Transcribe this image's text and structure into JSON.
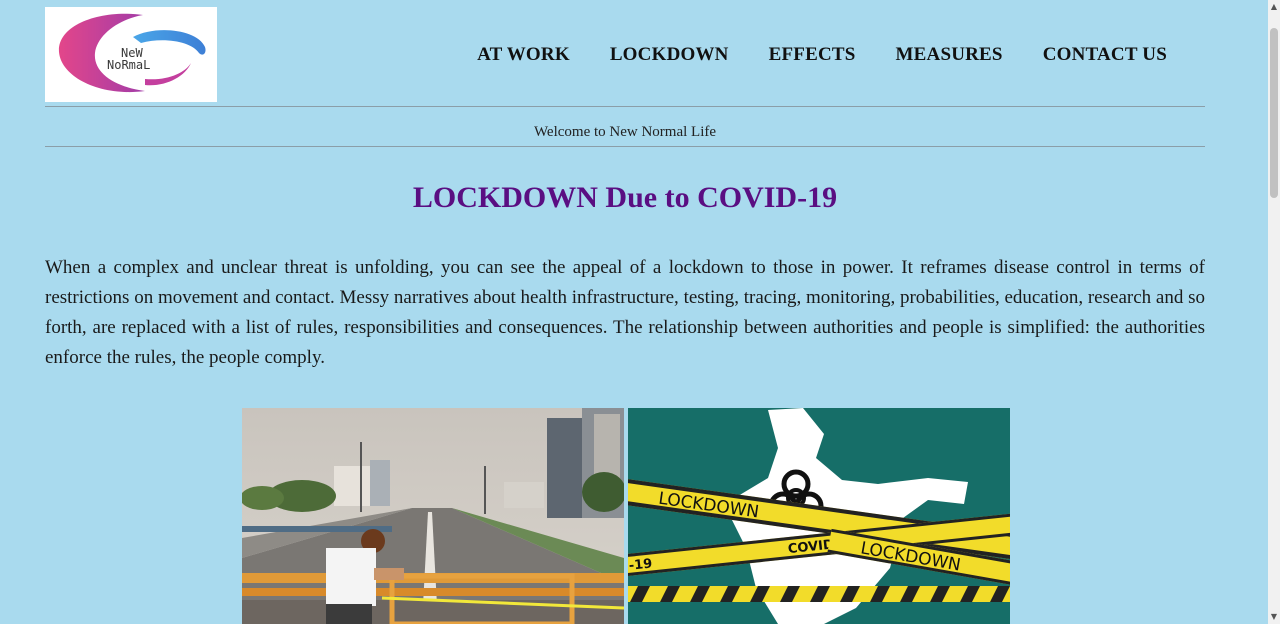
{
  "logo": {
    "line1": "NeW",
    "line2": "NoRmaL"
  },
  "nav": [
    {
      "label": "AT WORK"
    },
    {
      "label": "LOCKDOWN"
    },
    {
      "label": "EFFECTS"
    },
    {
      "label": "MEASURES"
    },
    {
      "label": "CONTACT US"
    }
  ],
  "welcome": "Welcome to New Normal Life",
  "title": "LOCKDOWN Due to COVID-19",
  "paragraph": "When a complex and unclear threat is unfolding, you can see the appeal of a lockdown to those in power. It reframes disease control in terms of restrictions on movement and contact. Messy narratives about health infrastructure, testing, tracing, monitoring, probabilities, education, research and so forth, are replaced with a list of rules, responsibilities and consequences. The relationship between authorities and people is simplified: the authorities enforce the rules, the people comply.",
  "images": {
    "right_tape_1": "LOCKDOWN",
    "right_tape_2": "COVID-19",
    "right_tape_3": "LOCKDOWN",
    "right_tape_4": "-19"
  },
  "colors": {
    "background": "#a9daee",
    "title": "#5a0e82",
    "teal": "#166e68",
    "tape": "#f2dc2a"
  },
  "icons": {
    "biohazard": "biohazard-icon",
    "scroll_up": "▲",
    "scroll_down": "▼"
  }
}
